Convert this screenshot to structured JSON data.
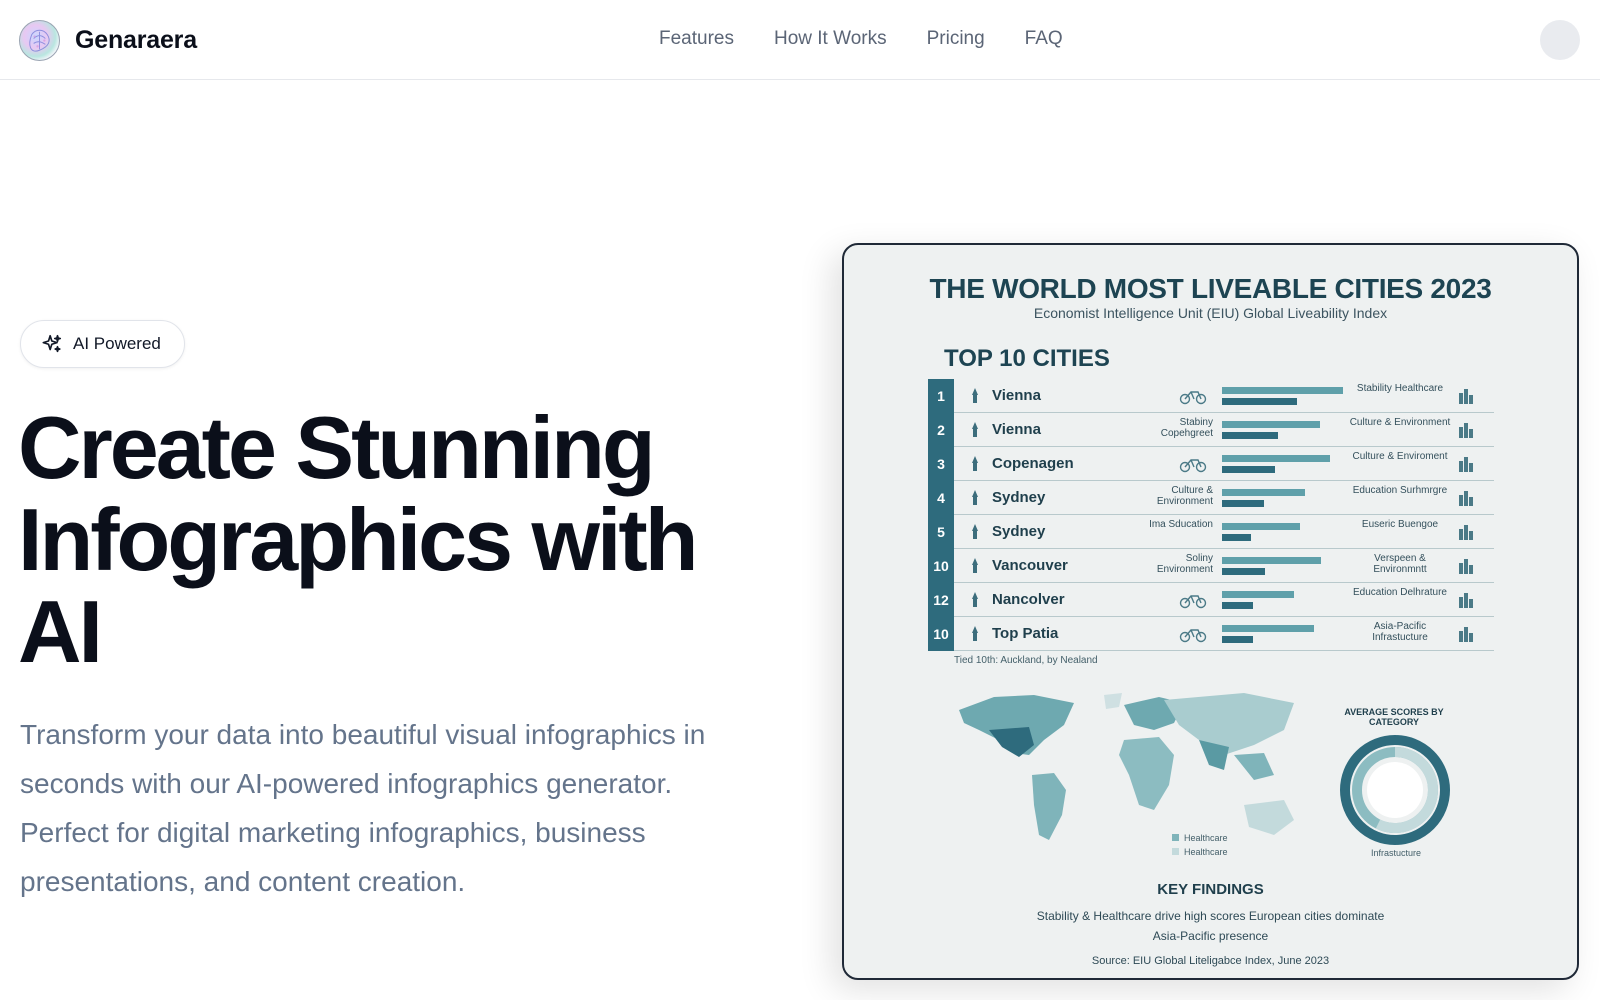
{
  "brand": {
    "name": "Genaraera",
    "logo_icon": "brain-logo-icon"
  },
  "nav": {
    "links": [
      "Features",
      "How It Works",
      "Pricing",
      "FAQ"
    ]
  },
  "badge": {
    "label": "AI Powered",
    "icon": "sparkles-icon"
  },
  "hero": {
    "title_lines": [
      "Create Stunning",
      "Infographics with",
      "AI"
    ],
    "subtitle": "Transform your data into beautiful visual infographics in seconds with our AI-powered infographics generator. Perfect for digital marketing infographics, business presentations, and content creation."
  },
  "infographic": {
    "title": "THE WORLD MOST LIVEABLE CITIES 2023",
    "subtitle": "Economist Intelligence Unit (EIU) Global Liveability Index",
    "section_title": "TOP 10 CITIES",
    "rows": [
      {
        "rank": "1",
        "city": "Vienna",
        "left": "",
        "right": "Stability Healthcare",
        "b1": 0.93,
        "b2": 0.58
      },
      {
        "rank": "2",
        "city": "Vienna",
        "left": "Stabiny Copehgreet",
        "right": "Culture & Environment",
        "b1": 0.75,
        "b2": 0.43
      },
      {
        "rank": "3",
        "city": "Copenagen",
        "left": "",
        "right": "Culture & Enviroment",
        "b1": 0.83,
        "b2": 0.41
      },
      {
        "rank": "4",
        "city": "Sydney",
        "left": "Culture & Environment",
        "right": "Education Surhmrgre",
        "b1": 0.64,
        "b2": 0.32
      },
      {
        "rank": "5",
        "city": "Sydney",
        "left": "Ima Sducation",
        "right": "Euseric Buengoe",
        "b1": 0.6,
        "b2": 0.22
      },
      {
        "rank": "10",
        "city": "Vancouver",
        "left": "Soliny Environment",
        "right": "Verspeen & Environmntt",
        "b1": 0.76,
        "b2": 0.33
      },
      {
        "rank": "12",
        "city": "Nancolver",
        "left": "",
        "right": "Education Delhrature",
        "b1": 0.55,
        "b2": 0.24
      },
      {
        "rank": "10",
        "city": "Top Patia",
        "left": "",
        "right": "Asia-Pacific Infrastucture",
        "b1": 0.71,
        "b2": 0.24
      }
    ],
    "tied_note": "Tied 10th: Auckland, by Nealand",
    "legend": [
      "Healthcare",
      "Healthcare"
    ],
    "avg_title": "AVERAGE SCORES BY CATEGORY",
    "donut_label": "Infrastucture",
    "key_findings_title": "KEY FINDINGS",
    "key_findings_1": "Stability & Healthcare drive high scores  European cities dominate",
    "key_findings_2": "Asia-Pacific presence",
    "source": "Source: EIU Global Liteligabce Index, June 2023"
  },
  "colors": {
    "accent": "#2e6b7d",
    "bar_light": "#5fa0aa",
    "card_bg": "#eef1f1"
  }
}
